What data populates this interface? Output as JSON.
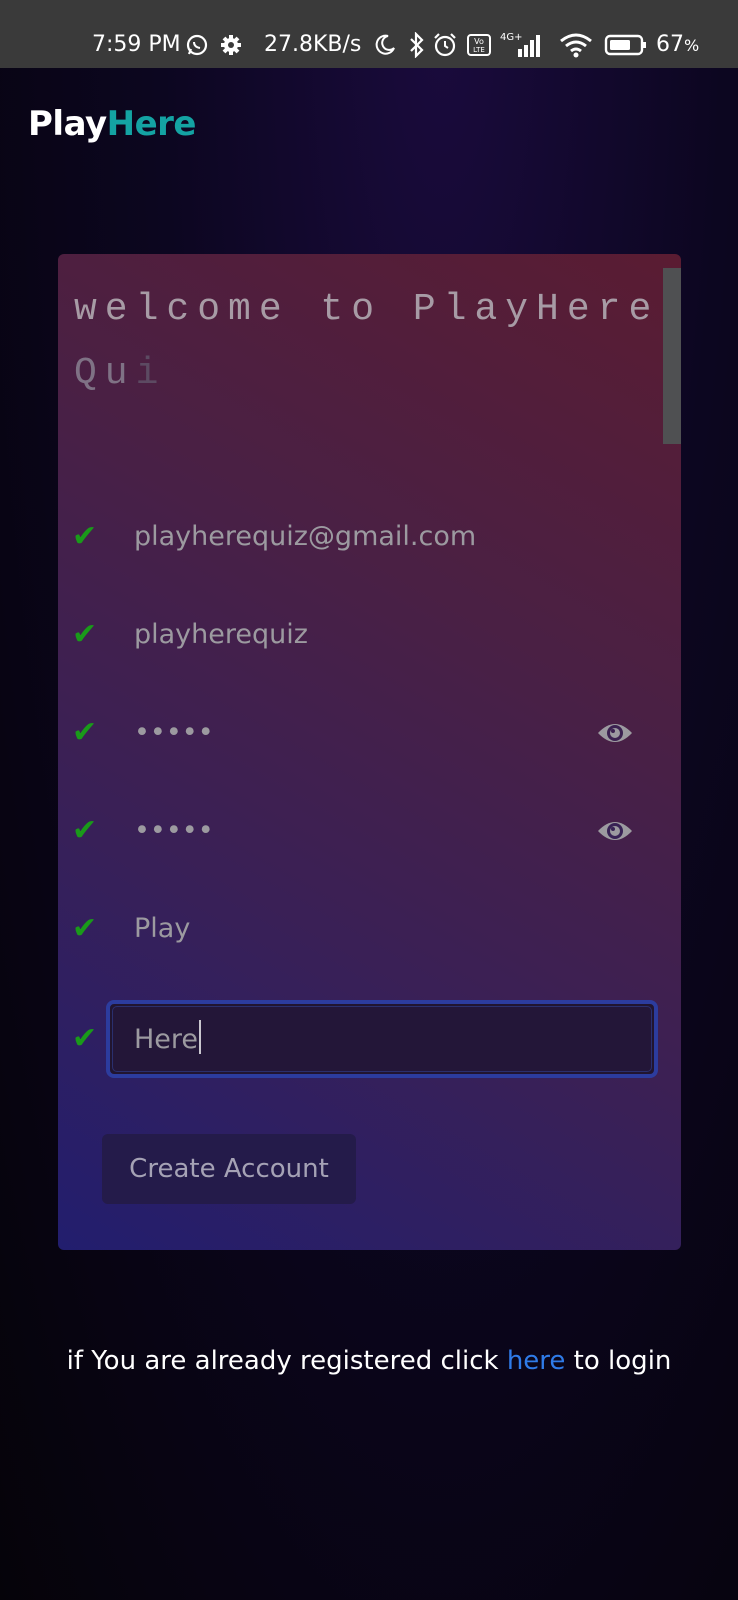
{
  "status_bar": {
    "time": "7:59 PM",
    "net_speed": "27.8KB/s",
    "battery": "67",
    "battery_unit": "%",
    "network": "4G+",
    "volte": "Vo LTE",
    "icons": [
      "whatsapp-icon",
      "gear-icon",
      "moon-icon",
      "bluetooth-icon",
      "alarm-icon",
      "volte-icon",
      "signal-icon",
      "wifi-icon",
      "battery-icon"
    ]
  },
  "header": {
    "logo_play": "Play",
    "logo_here": "Here"
  },
  "card": {
    "welcome_main": "welcome to PlayHere ",
    "welcome_fade1": "Qu",
    "welcome_fade2": "i",
    "fields": [
      {
        "value": "playherequiz@gmail.com",
        "valid": true
      },
      {
        "value": "playherequiz",
        "valid": true
      },
      {
        "value": "•••••",
        "valid": true,
        "has_eye": true
      },
      {
        "value": "•••••",
        "valid": true,
        "has_eye": true
      },
      {
        "value": "Play",
        "valid": true
      },
      {
        "value": "Here",
        "valid": true,
        "focused": true
      }
    ],
    "check_glyph": "✔",
    "create_button": "Create Account"
  },
  "footer": {
    "before": "if You are already registered click ",
    "link": "here",
    "after": " to login"
  },
  "colors": {
    "accent_teal": "#14a3a3",
    "link_blue": "#2f7be8",
    "check_green": "#1a9a1a",
    "focus_border": "#2c3c9e"
  }
}
